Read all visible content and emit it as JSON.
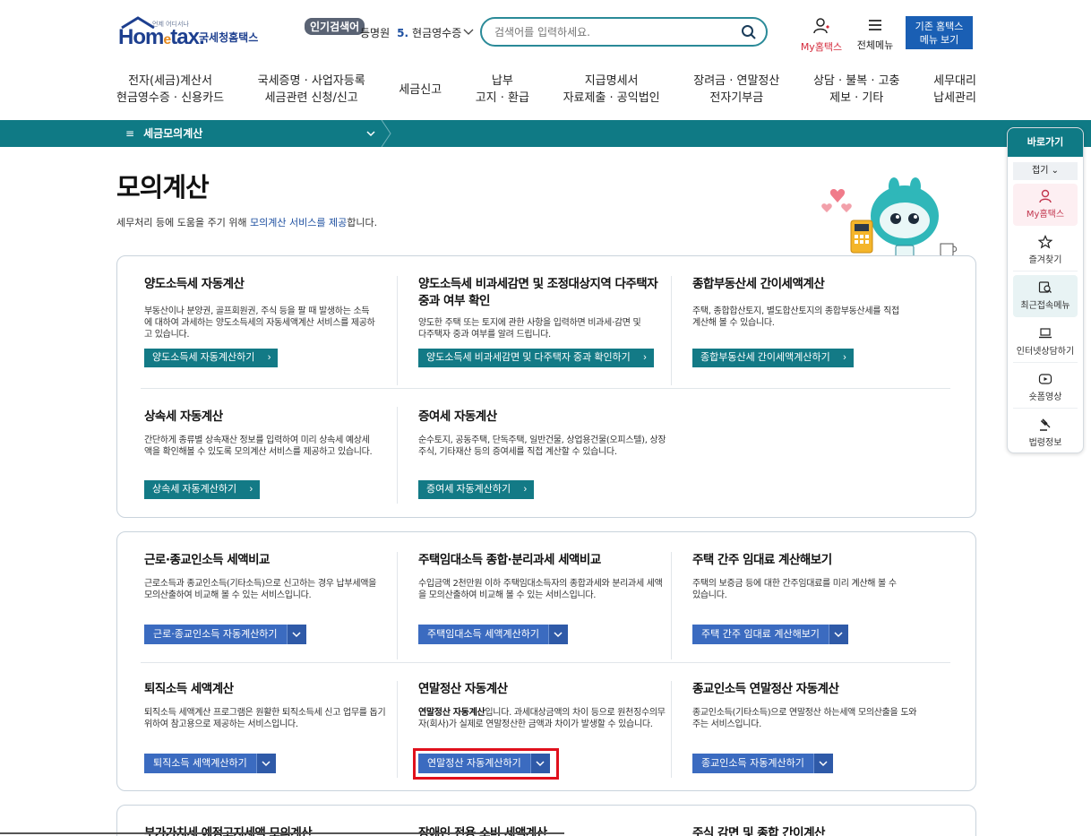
{
  "header": {
    "logo_tagline": "언제 어디서나",
    "logo_brand_left": "Hom",
    "logo_brand_e": "e",
    "logo_brand_right": "tax.",
    "logo_korname": "국세청홈택스",
    "popular_badge": "인기검색어",
    "popular_prev": "등명원",
    "popular_rank": "5.",
    "popular_term": "현금영수증",
    "search_placeholder": "검색어를 입력하세요.",
    "my_hometax": "My홈택스",
    "all_menu": "전체메뉴",
    "legacy_line1": "기존 홈택스",
    "legacy_line2": "메뉴 보기"
  },
  "gnb": [
    {
      "line1": "전자(세금)계산서",
      "line2": "현금영수증 · 신용카드"
    },
    {
      "line1": "국세증명 · 사업자등록",
      "line2": "세금관련 신청/신고"
    },
    {
      "line1": "세금신고",
      "line2": ""
    },
    {
      "line1": "납부",
      "line2": "고지 · 환급"
    },
    {
      "line1": "지급명세서",
      "line2": "자료제출 · 공익법인"
    },
    {
      "line1": "장려금 · 연말정산",
      "line2": "전자기부금"
    },
    {
      "line1": "상담 · 불복 · 고충",
      "line2": "제보 · 기타"
    },
    {
      "line1": "세무대리",
      "line2": "납세관리"
    }
  ],
  "breadcrumb": {
    "label": "세금모의계산"
  },
  "page": {
    "title": "모의계산",
    "desc_pre": "세무처리 등에 도움을 주기 위해 ",
    "desc_hl": "모의계산 서비스를 제공",
    "desc_post": "합니다."
  },
  "group1": [
    {
      "title": "양도소득세 자동계산",
      "desc": "부동산이나 분양권, 골프회원권, 주식 등을 팔 때 발생하는 소득에 대하여 과세하는 양도소득세의 자동세액계산 서비스를 제공하고 있습니다.",
      "button": "양도소득세 자동계산하기"
    },
    {
      "title": "양도소득세 비과세감면 및 조정대상지역 다주택자 중과 여부 확인",
      "desc": "양도한 주택 또는 토지에 관한 사항을 입력하면 비과세·감면 및 다주택자 중과 여부를 알려 드립니다.",
      "button": "양도소득세 비과세감면 및 다주택자 중과 확인하기"
    },
    {
      "title": "종합부동산세 간이세액계산",
      "desc": "주택, 종합합산토지, 별도합산토지의 종합부동산세를 직접 계산해 볼 수 있습니다.",
      "button": "종합부동산세 간이세액계산하기"
    },
    {
      "title": "상속세 자동계산",
      "desc": "간단하게 종류별 상속재산 정보를 입력하여 미리 상속세 예상세액을 확인해볼 수 있도록 모의계산 서비스를 제공하고 있습니다.",
      "button": "상속세 자동계산하기"
    },
    {
      "title": "증여세 자동계산",
      "desc": "순수토지, 공동주택, 단독주택, 일반건물, 상업용건물(오피스텔), 상장주식, 기타재산 등의 증여세를 직접 계산할 수 있습니다.",
      "button": "증여세 자동계산하기"
    }
  ],
  "group2": [
    {
      "title": "근로·종교인소득 세액비교",
      "desc": "근로소득과 종교인소득(기타소득)으로 신고하는 경우 납부세액을 모의산출하여 비교해 볼 수 있는 서비스입니다.",
      "button": "근로·종교인소득 자동계산하기"
    },
    {
      "title": "주택임대소득 종합·분리과세 세액비교",
      "desc": "수입금액 2천만원 이하 주택임대소득자의 종합과세와 분리과세 세액을 모의산출하여 비교해 볼 수 있는 서비스입니다.",
      "button": "주택임대소득 세액계산하기"
    },
    {
      "title": "주택 간주 임대료 계산해보기",
      "desc": "주택의 보증금 등에 대한 간주임대료를 미리 계산해 볼 수 있습니다.",
      "button": "주택 간주 임대료 계산해보기"
    },
    {
      "title": "퇴직소득 세액계산",
      "desc": "퇴직소득 세액계산 프로그램은 원활한 퇴직소득세 신고 업무를 돕기 위하여 참고용으로 제공하는 서비스입니다.",
      "button": "퇴직소득 세액계산하기"
    },
    {
      "title": "연말정산 자동계산",
      "desc_bold": "연말정산 자동계산",
      "desc": "입니다. 과세대상금액의 차이 등으로 원천징수의무자(회사)가 실제로 연말정산한 금액과 차이가 발생할 수 있습니다.",
      "button": "연말정산 자동계산하기"
    },
    {
      "title": "종교인소득 연말정산 자동계산",
      "desc": "종교인소득(기타소득)으로 연말정산 하는세액 모의산출을 도와주는 서비스입니다.",
      "button": "종교인소득 자동계산하기"
    }
  ],
  "group3": [
    {
      "title": "부가가치세 예정고지세액 모의계산"
    },
    {
      "title": "장애인 전용 소비 세액계산"
    },
    {
      "title": "주식 감면 및 종합 간이계산"
    }
  ],
  "quick": {
    "title": "바로가기",
    "fold": "접기",
    "items": [
      {
        "label": "My홈택스",
        "icon": "person-icon"
      },
      {
        "label": "즐겨찾기",
        "icon": "star-icon"
      },
      {
        "label": "최근접속메뉴",
        "icon": "recent-search-icon"
      },
      {
        "label": "인터넷상담하기",
        "icon": "laptop-icon"
      },
      {
        "label": "숏폼영상",
        "icon": "play-icon"
      },
      {
        "label": "법령정보",
        "icon": "gavel-icon"
      }
    ]
  },
  "colors": {
    "teal": "#0f7a85",
    "button_teal": "#137a86",
    "button_blue": "#3b6bc0",
    "highlight_red": "#e0101c",
    "accent_red": "#d42a3b"
  }
}
